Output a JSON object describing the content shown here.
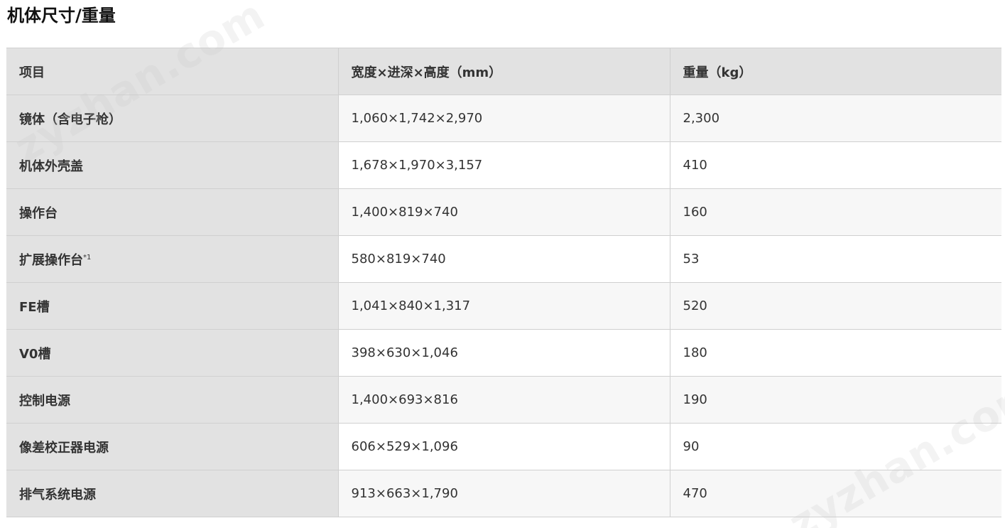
{
  "page": {
    "title": "机体尺寸/重量",
    "watermark": "zyzhan.com"
  },
  "table": {
    "headers": {
      "item": "项目",
      "dimensions": "宽度×进深×高度（mm）",
      "weight": "重量（kg）"
    },
    "rows": [
      {
        "name": "镜体（含电子枪）",
        "note": "",
        "dimensions": "1,060×1,742×2,970",
        "weight": "2,300"
      },
      {
        "name": "机体外壳盖",
        "note": "",
        "dimensions": "1,678×1,970×3,157",
        "weight": "410"
      },
      {
        "name": "操作台",
        "note": "",
        "dimensions": "1,400×819×740",
        "weight": "160"
      },
      {
        "name": "扩展操作台",
        "note": "*1",
        "dimensions": "580×819×740",
        "weight": "53"
      },
      {
        "name": "FE槽",
        "note": "",
        "dimensions": "1,041×840×1,317",
        "weight": "520"
      },
      {
        "name": "V0槽",
        "note": "",
        "dimensions": "398×630×1,046",
        "weight": "180"
      },
      {
        "name": "控制电源",
        "note": "",
        "dimensions": "1,400×693×816",
        "weight": "190"
      },
      {
        "name": "像差校正器电源",
        "note": "",
        "dimensions": "606×529×1,096",
        "weight": "90"
      },
      {
        "name": "排气系统电源",
        "note": "",
        "dimensions": "913×663×1,790",
        "weight": "470"
      }
    ]
  }
}
